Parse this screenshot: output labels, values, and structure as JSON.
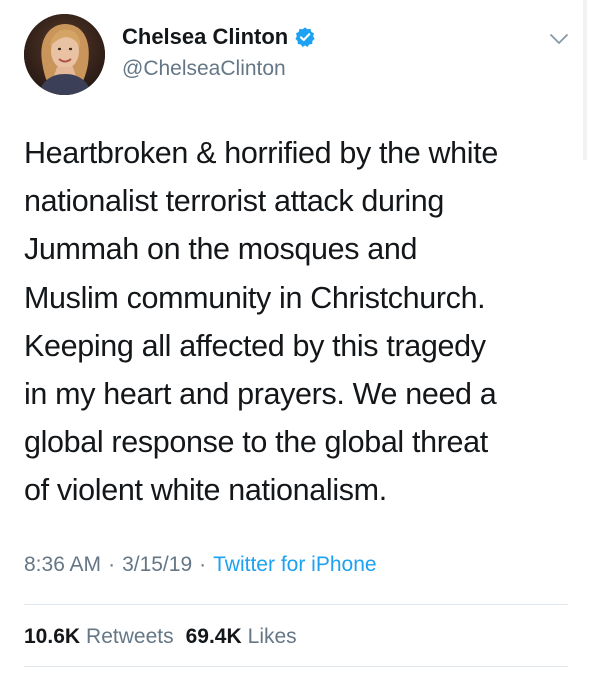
{
  "author": {
    "display_name": "Chelsea Clinton",
    "handle": "@ChelseaClinton",
    "verified": true,
    "avatar_icon": "profile-photo"
  },
  "tweet": {
    "text": "Heartbroken & horrified by the white\nnationalist terrorist attack during\nJummah on the mosques and\nMuslim community in Christchurch.\nKeeping all affected by this tragedy\nin my heart and prayers. We need a\nglobal response to the global threat\nof violent white nationalism."
  },
  "meta": {
    "time": "8:36 AM",
    "separator": "·",
    "date": "3/15/19",
    "source": "Twitter for iPhone"
  },
  "stats": {
    "retweets_count": "10.6K",
    "retweets_label": "Retweets",
    "likes_count": "69.4K",
    "likes_label": "Likes"
  },
  "colors": {
    "text": "#14171a",
    "secondary": "#657786",
    "link": "#1da1f2",
    "divider": "#e1e8ed"
  },
  "icons": {
    "verified": "verified-badge-icon",
    "menu": "chevron-down-icon"
  }
}
